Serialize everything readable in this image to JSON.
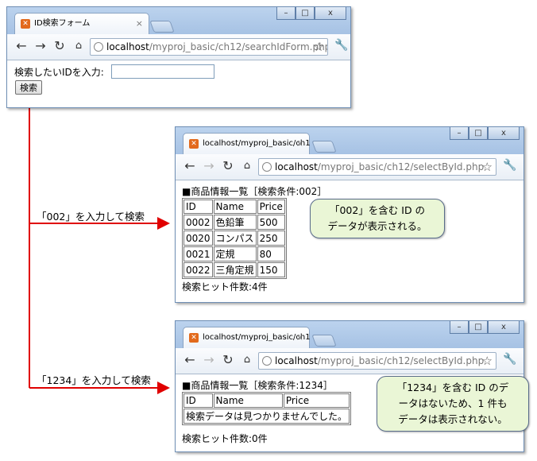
{
  "window1": {
    "tab_title": "ID検索フォーム",
    "url_host": "localhost",
    "url_path": "/myproj_basic/ch12/searchIdForm.php",
    "prompt_label": "検索したいIDを入力:",
    "search_input_value": "",
    "search_button_label": "検索"
  },
  "window2": {
    "tab_title": "localhost/myproj_basic/ch1",
    "url_host": "localhost",
    "url_path": "/myproj_basic/ch12/selectById.php",
    "heading": "■商品情報一覧［検索条件:002］",
    "columns": [
      "ID",
      "Name",
      "Price"
    ],
    "rows": [
      [
        "0002",
        "色鉛筆",
        "500"
      ],
      [
        "0020",
        "コンパス",
        "250"
      ],
      [
        "0021",
        "定規",
        "80"
      ],
      [
        "0022",
        "三角定規",
        "150"
      ]
    ],
    "hit_count": "検索ヒット件数:4件"
  },
  "window3": {
    "tab_title": "localhost/myproj_basic/ch1",
    "url_host": "localhost",
    "url_path": "/myproj_basic/ch12/selectById.php",
    "heading": "■商品情報一覧［検索条件:1234］",
    "columns": [
      "ID",
      "Name",
      "Price"
    ],
    "no_data_message": "検索データは見つかりませんでした。",
    "hit_count": "検索ヒット件数:0件"
  },
  "annotations": {
    "label_002": "「002」を入力して検索",
    "label_1234": "「1234」を入力して検索",
    "callout_002_line1": "「002」を含む ID の",
    "callout_002_line2": "データが表示される。",
    "callout_1234_line1": "「1234」を含む ID のデ",
    "callout_1234_line2": "ータはないため、1 件も",
    "callout_1234_line3": "データは表示されない。"
  },
  "icons": {
    "back": "back-arrow-icon",
    "forward": "forward-arrow-icon",
    "reload": "reload-icon",
    "home": "home-icon",
    "globe": "globe-icon",
    "star": "star-icon",
    "wrench": "wrench-icon",
    "favicon": "xampp-favicon-icon"
  },
  "colors": {
    "annotation_red": "#e00000",
    "callout_fill": "#eaf6d6",
    "window_frame": "#a6c2e4"
  }
}
